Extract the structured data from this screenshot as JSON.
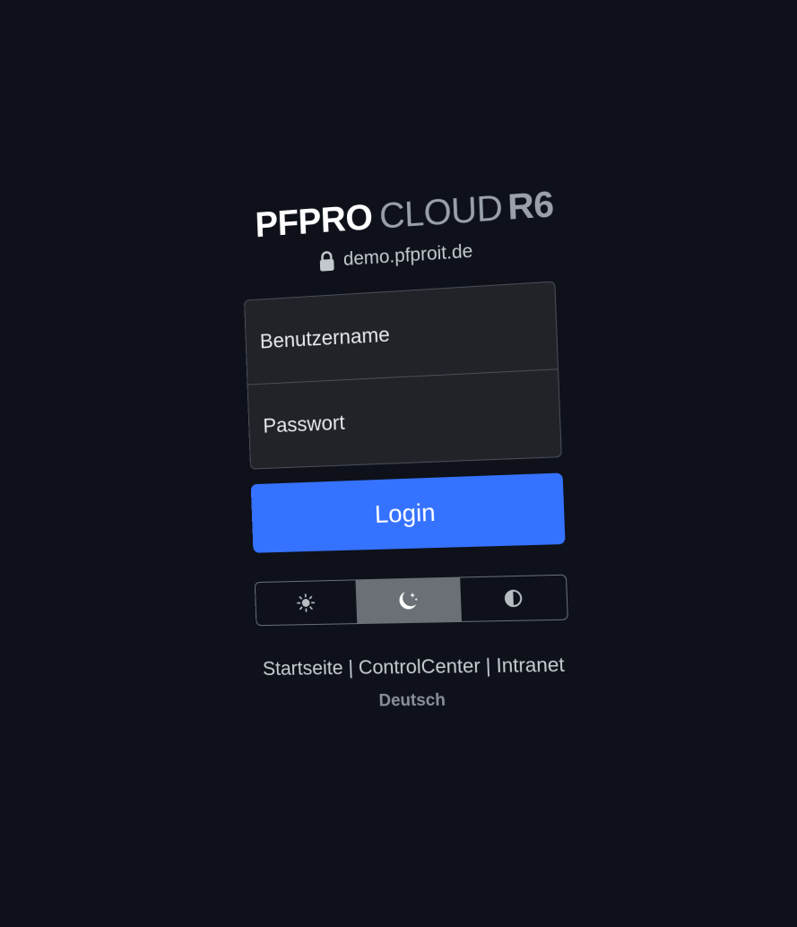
{
  "brand": {
    "name_bold": "PFPRO",
    "name_light": "CLOUD",
    "release": "R6",
    "logo_color": "#e0242b"
  },
  "host": {
    "icon": "lock-icon",
    "domain": "demo.pfproit.de"
  },
  "form": {
    "username_placeholder": "Benutzername",
    "username_value": "",
    "password_placeholder": "Passwort",
    "password_value": "",
    "login_label": "Login",
    "login_color": "#3572ff"
  },
  "theme_switch": {
    "options": [
      {
        "icon": "sun-icon",
        "mode": "light"
      },
      {
        "icon": "moon-stars-icon",
        "mode": "dark"
      },
      {
        "icon": "contrast-half-icon",
        "mode": "auto"
      }
    ],
    "selected": "dark"
  },
  "footer": {
    "links": [
      "Startseite",
      "ControlCenter",
      "Intranet"
    ],
    "separator": "|",
    "language": "Deutsch"
  }
}
